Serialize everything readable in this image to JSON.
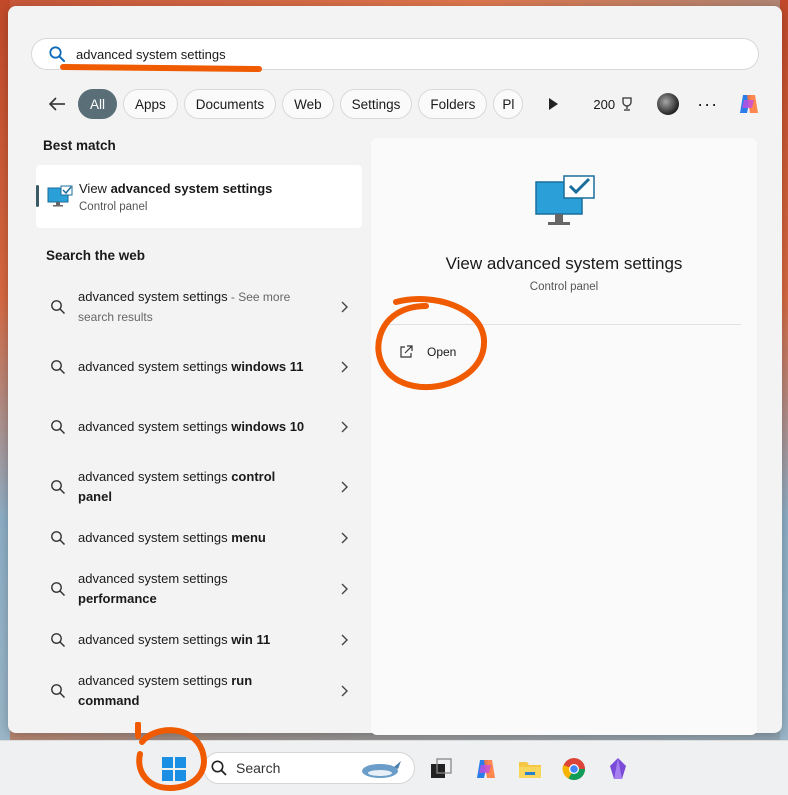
{
  "search": {
    "query": "advanced system settings"
  },
  "filters": {
    "chips": [
      {
        "label": "All",
        "active": true
      },
      {
        "label": "Apps"
      },
      {
        "label": "Documents"
      },
      {
        "label": "Web"
      },
      {
        "label": "Settings"
      },
      {
        "label": "Folders"
      },
      {
        "label": "Pl"
      }
    ],
    "points": "200"
  },
  "best_match": {
    "title": "Best match",
    "item_prefix": "View ",
    "item_bold": "advanced system settings",
    "item_sub": "Control panel"
  },
  "web": {
    "title": "Search the web",
    "items": [
      {
        "normal": "advanced system settings",
        "muted": " - See more search results",
        "bold": ""
      },
      {
        "normal": "advanced system settings ",
        "bold": "windows 11"
      },
      {
        "normal": "advanced system settings ",
        "bold": "windows 10"
      },
      {
        "normal": "advanced system settings ",
        "bold": "control panel"
      },
      {
        "normal": "advanced system settings ",
        "bold": "menu"
      },
      {
        "normal": "advanced system settings ",
        "bold": "performance"
      },
      {
        "normal": "advanced system settings ",
        "bold": "win 11"
      },
      {
        "normal": "advanced system settings ",
        "bold": "run command"
      }
    ]
  },
  "detail": {
    "title": "View advanced system settings",
    "subtitle": "Control panel",
    "action_open": "Open"
  },
  "taskbar": {
    "search_label": "Search"
  },
  "colors": {
    "accent": "#5a6e77",
    "annotation": "#f05a00"
  }
}
